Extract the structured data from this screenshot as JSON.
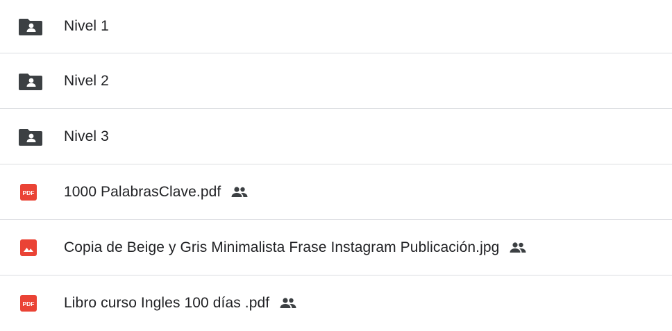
{
  "files": [
    {
      "name": "Nivel 1",
      "icon": "shared-folder-icon",
      "shared": false
    },
    {
      "name": "Nivel 2",
      "icon": "shared-folder-icon",
      "shared": false
    },
    {
      "name": "Nivel 3",
      "icon": "shared-folder-icon",
      "shared": false
    },
    {
      "name": "1000 PalabrasClave.pdf",
      "icon": "pdf-icon",
      "badge": "PDF",
      "shared": true
    },
    {
      "name": "Copia de Beige y Gris Minimalista Frase Instagram Publicación.jpg",
      "icon": "image-icon",
      "shared": true
    },
    {
      "name": "Libro curso Ingles 100 días .pdf",
      "icon": "pdf-icon",
      "badge": "PDF",
      "shared": true
    }
  ],
  "colors": {
    "folder": "#3c4043",
    "pdf": "#ea4335",
    "image": "#ea4335",
    "shared": "#3c4043",
    "divider": "#dadce0"
  }
}
